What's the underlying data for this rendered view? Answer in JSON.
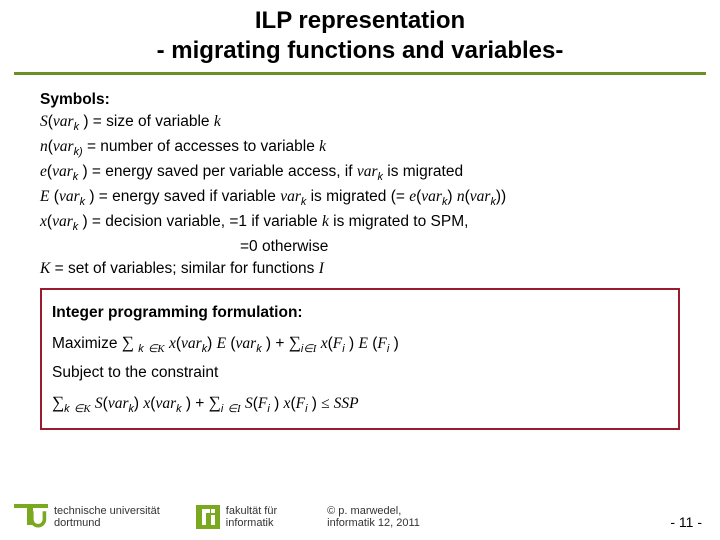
{
  "title_line1": "ILP representation",
  "title_line2": "- migrating functions and variables-",
  "symbols_heading": "Symbols:",
  "sym": {
    "S_lhs": "S",
    "arg": "var",
    "eq_size": " = size of variable ",
    "k": "k",
    "n_lhs": "n",
    "eq_n": " = number of accesses to variable ",
    "e_lhs": "e",
    "eq_e": " = energy saved per variable access, if ",
    "eq_e_tail": " is migrated",
    "E_lhs": "E",
    "eq_E": " = energy saved if variable ",
    "eq_E_mid": " is migrated (= ",
    "eq_E_tail": ")",
    "x_lhs": "x",
    "eq_x": " = decision variable, =1 if variable ",
    "eq_x_tail": " is migrated to SPM,",
    "x_line2": "=0 otherwise",
    "K_lhs": "K",
    "eq_K": " = set of variables; similar for functions ",
    "I": "I"
  },
  "ip": {
    "heading": "Integer programming formulation:",
    "maximize": "Maximize ",
    "sum": "∑",
    "in": "∈",
    "plus": " + ",
    "K": "K",
    "I": "I",
    "k": "k",
    "i": "i",
    "x": "x",
    "var": "var",
    "E": "E",
    "F": "F",
    "S": "S",
    "subject": "Subject to the constraint",
    "le": "≤",
    "ssp": " SSP"
  },
  "footer": {
    "uni1": "technische universität",
    "uni2": "dortmund",
    "fak1": "fakultät für",
    "fak2": "informatik",
    "copy1": "© p. marwedel,",
    "copy2": "informatik 12,  2011",
    "page": "-  11 -"
  }
}
